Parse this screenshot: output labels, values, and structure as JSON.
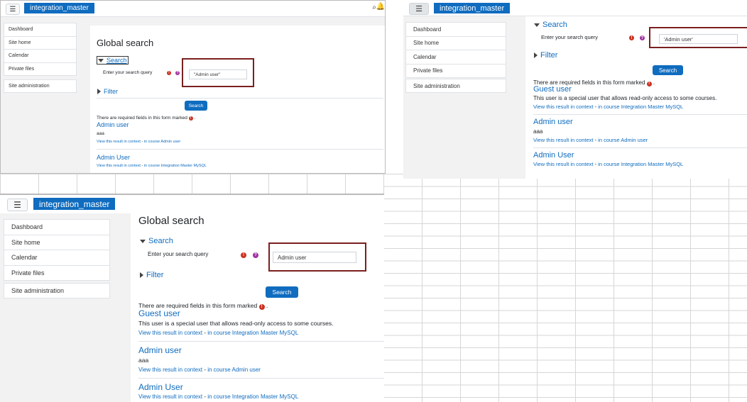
{
  "app": {
    "brand": "integration_master"
  },
  "nav": {
    "items": [
      "Dashboard",
      "Site home",
      "Calendar",
      "Private files"
    ],
    "admin": "Site administration"
  },
  "page": {
    "title": "Global search",
    "search_legend": "Search",
    "filter_legend": "Filter",
    "query_label": "Enter your search query",
    "required_note": "There are required fields in this form marked",
    "search_button": "Search"
  },
  "panels": {
    "top_left": {
      "query_value": "\"Admin user\""
    },
    "top_right": {
      "query_value": "'Admin user'"
    },
    "bottom": {
      "query_value": "Admin user"
    }
  },
  "results": {
    "guest": {
      "title": "Guest user",
      "desc": "This user is a special user that allows read-only access to some courses.",
      "context": "View this result in context",
      "course": "in course Integration Master MySQL"
    },
    "admin_lower": {
      "title": "Admin user",
      "desc": "aaa",
      "context": "View this result in context",
      "course": "in course Admin user"
    },
    "admin_upper": {
      "title": "Admin User",
      "context": "View this result in context",
      "course": "in course Integration Master MySQL"
    }
  },
  "icons": {
    "menu": "hamburger-icon",
    "search": "search-icon",
    "bell": "bell-icon",
    "required": "exclamation-icon",
    "help": "question-icon"
  },
  "colors": {
    "brand": "#0f6cbf",
    "highlight": "#7a1f1f",
    "required": "#ca3120",
    "help": "#a033a0"
  }
}
